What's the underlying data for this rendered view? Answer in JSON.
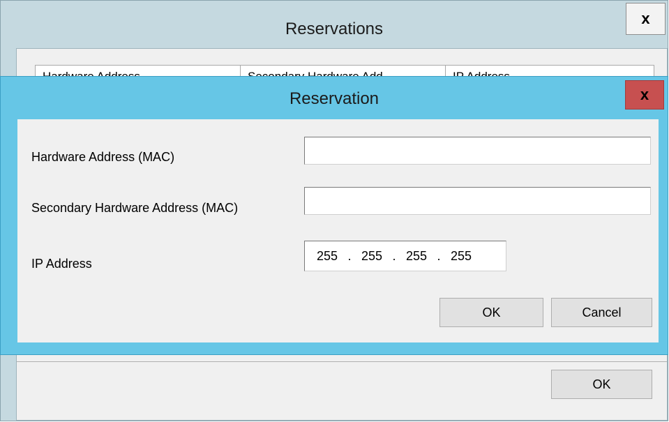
{
  "parent_window": {
    "title": "Reservations",
    "close_glyph": "x",
    "columns": [
      {
        "label": "Hardware Address"
      },
      {
        "label": "Secondary Hardware Add"
      },
      {
        "label": "IP Address"
      }
    ],
    "ok_label": "OK"
  },
  "dialog": {
    "title": "Reservation",
    "close_glyph": "x",
    "fields": {
      "mac": {
        "label": "Hardware Address (MAC)",
        "value": ""
      },
      "secondary_mac": {
        "label": "Secondary Hardware Address (MAC)",
        "value": ""
      },
      "ip": {
        "label": "IP Address",
        "octets": [
          "255",
          "255",
          "255",
          "255"
        ],
        "separator": "."
      }
    },
    "ok_label": "OK",
    "cancel_label": "Cancel"
  },
  "colors": {
    "dialog_frame": "#66c6e6",
    "close_button_red": "#c75050",
    "parent_frame": "#c5d9e0"
  }
}
